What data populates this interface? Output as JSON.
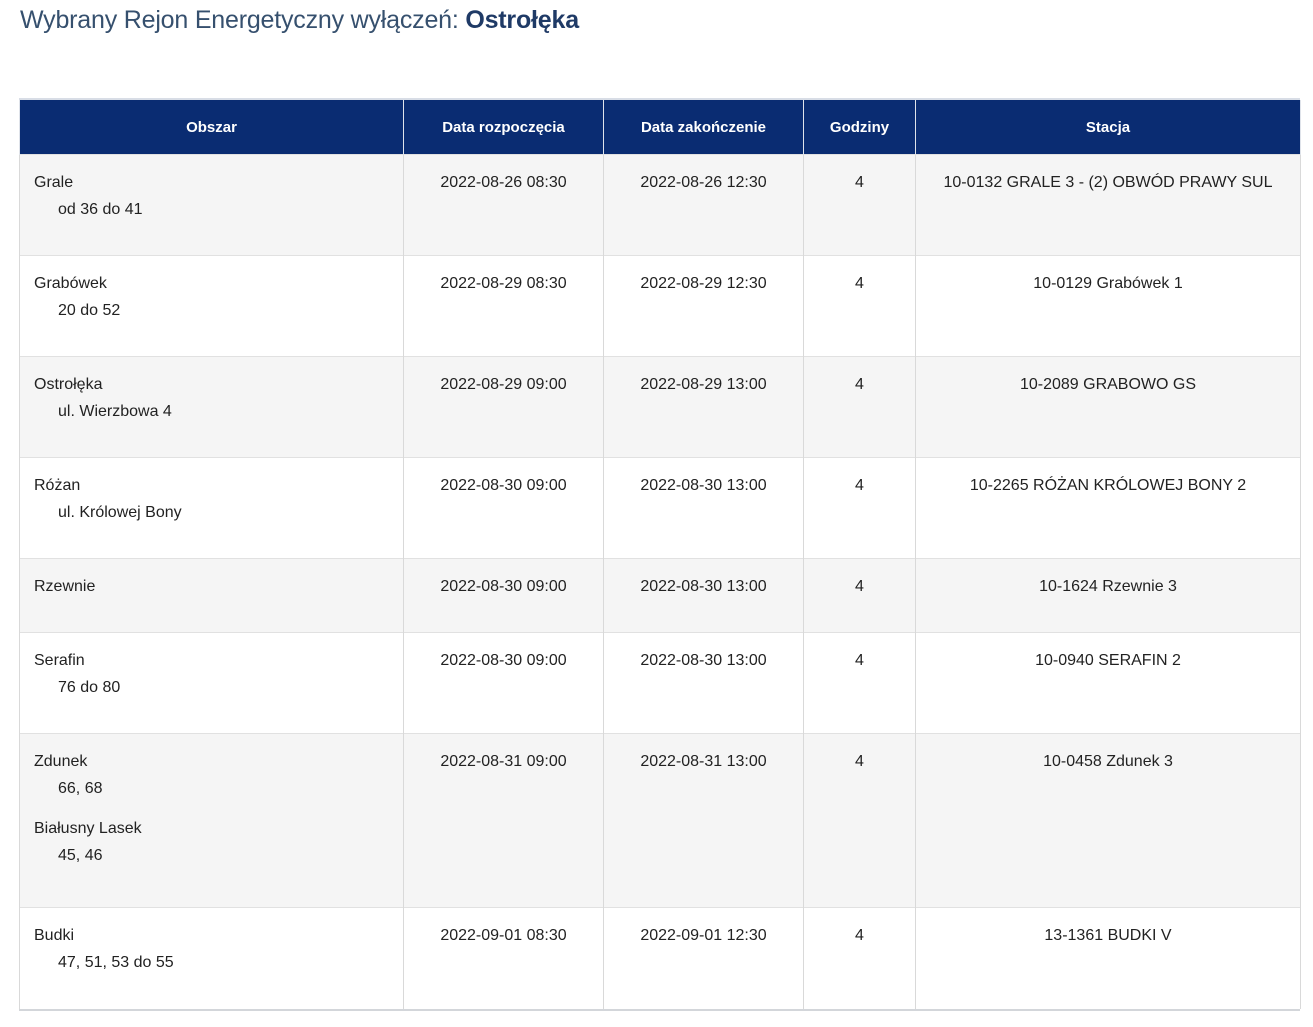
{
  "title": {
    "prefix": "Wybrany Rejon Energetyczny wyłączeń:",
    "region": "Ostrołęka"
  },
  "table": {
    "headers": {
      "area": "Obszar",
      "start": "Data rozpoczęcia",
      "end": "Data zakończenie",
      "hours": "Godziny",
      "station": "Stacja"
    },
    "rows": [
      {
        "areas": [
          {
            "name": "Grale",
            "detail": "od 36 do 41"
          }
        ],
        "start": "2022-08-26 08:30",
        "end": "2022-08-26 12:30",
        "hours": "4",
        "station": "10-0132 GRALE 3 - (2) OBWÓD PRAWY SUL"
      },
      {
        "areas": [
          {
            "name": "Grabówek",
            "detail": "20 do 52"
          }
        ],
        "start": "2022-08-29 08:30",
        "end": "2022-08-29 12:30",
        "hours": "4",
        "station": "10-0129 Grabówek 1"
      },
      {
        "areas": [
          {
            "name": "Ostrołęka",
            "detail": "ul. Wierzbowa 4"
          }
        ],
        "start": "2022-08-29 09:00",
        "end": "2022-08-29 13:00",
        "hours": "4",
        "station": "10-2089 GRABOWO GS"
      },
      {
        "areas": [
          {
            "name": "Różan",
            "detail": "ul. Królowej Bony"
          }
        ],
        "start": "2022-08-30 09:00",
        "end": "2022-08-30 13:00",
        "hours": "4",
        "station": "10-2265 RÓŻAN KRÓLOWEJ BONY 2"
      },
      {
        "areas": [
          {
            "name": "Rzewnie",
            "detail": ""
          }
        ],
        "start": "2022-08-30 09:00",
        "end": "2022-08-30 13:00",
        "hours": "4",
        "station": "10-1624 Rzewnie 3"
      },
      {
        "areas": [
          {
            "name": "Serafin",
            "detail": "76 do 80"
          }
        ],
        "start": "2022-08-30 09:00",
        "end": "2022-08-30 13:00",
        "hours": "4",
        "station": "10-0940 SERAFIN 2"
      },
      {
        "areas": [
          {
            "name": "Zdunek",
            "detail": "66, 68"
          },
          {
            "name": "Białusny Lasek",
            "detail": "45, 46"
          }
        ],
        "start": "2022-08-31 09:00",
        "end": "2022-08-31 13:00",
        "hours": "4",
        "station": "10-0458 Zdunek 3"
      },
      {
        "areas": [
          {
            "name": "Budki",
            "detail": "47, 51, 53 do 55"
          }
        ],
        "start": "2022-09-01 08:30",
        "end": "2022-09-01 12:30",
        "hours": "4",
        "station": "13-1361 BUDKI V"
      }
    ]
  }
}
